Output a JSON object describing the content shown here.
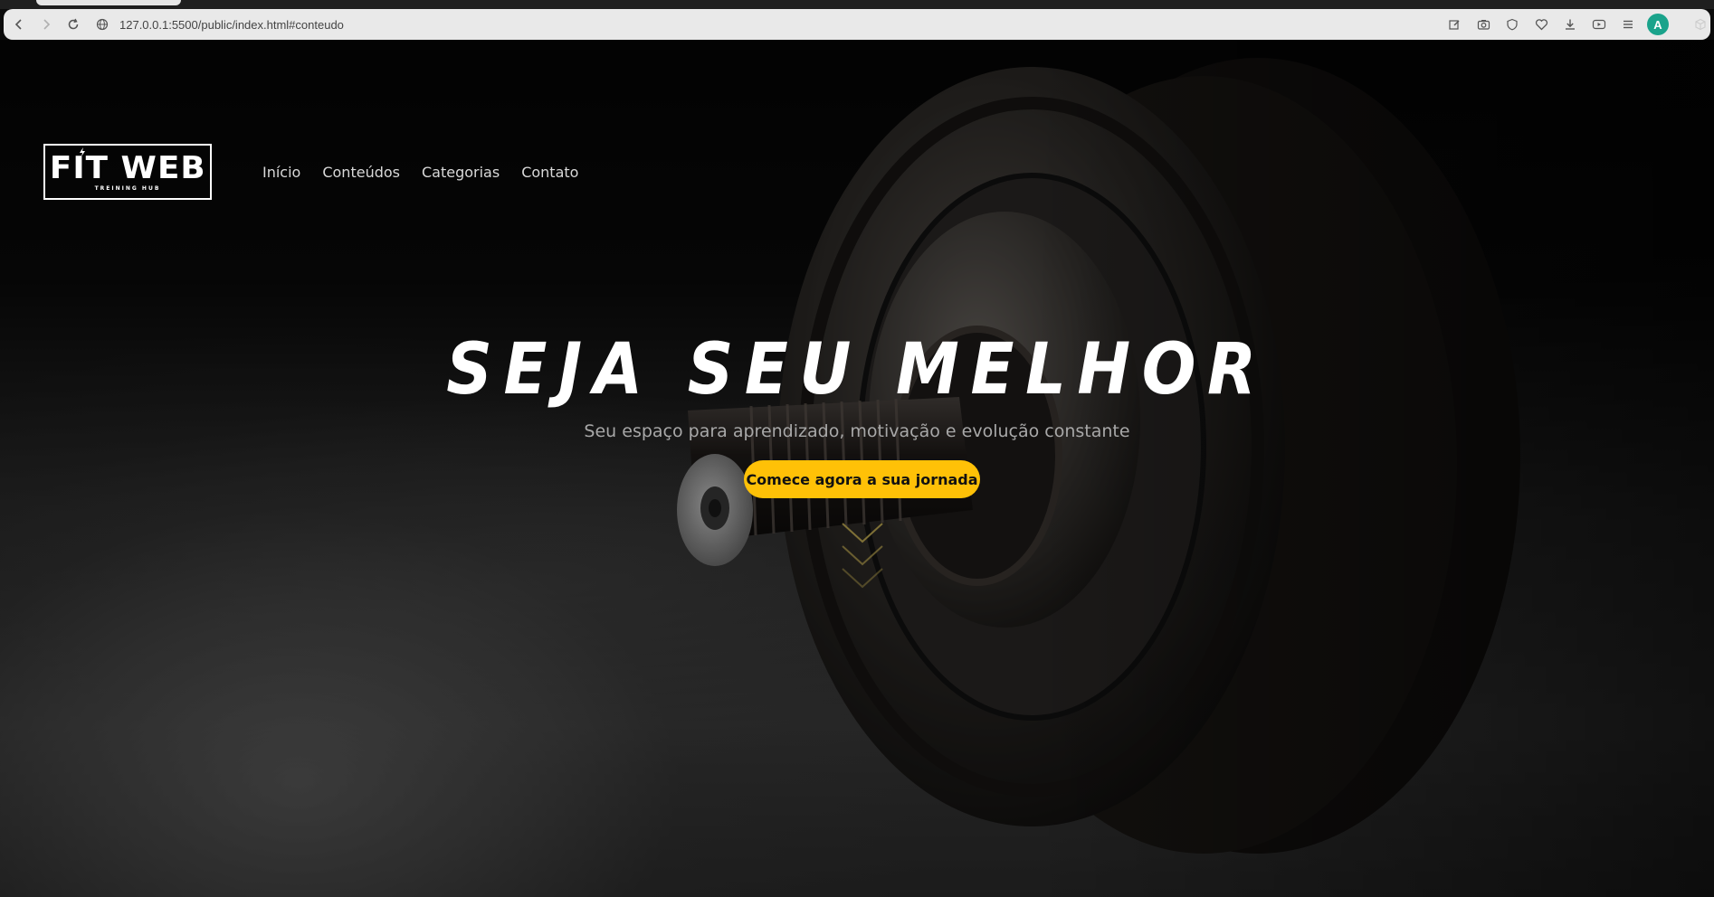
{
  "browser": {
    "url": "127.0.0.1:5500/public/index.html#conteudo",
    "profile_initial": "A",
    "icons": [
      "back-icon",
      "forward-icon",
      "reload-icon",
      "site-info-icon",
      "edit-icon",
      "screenshot-icon",
      "shield-icon",
      "favorite-icon",
      "download-icon",
      "media-icon",
      "menu-icon",
      "extensions-icon"
    ]
  },
  "site": {
    "logo": {
      "main": "FIT WEB",
      "sub": "TREINING HUB"
    },
    "nav": [
      "Início",
      "Conteúdos",
      "Categorias",
      "Contato"
    ],
    "hero": {
      "headline": "SEJA SEU MELHOR",
      "subtitle": "Seu espaço para aprendizado, motivação e evolução constante",
      "cta": "Comece agora a sua jornada"
    },
    "colors": {
      "accent": "#ffc107",
      "background": "#0b0b0b",
      "text": "#ffffff"
    }
  }
}
